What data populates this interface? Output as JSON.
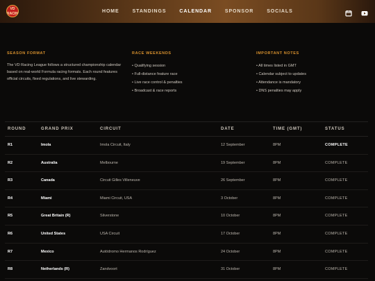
{
  "header": {
    "logo_text": "VD RACING",
    "nav": [
      "HOME",
      "STANDINGS",
      "CALENDAR",
      "SPONSOR",
      "SOCIALS"
    ],
    "active": "CALENDAR",
    "icons": [
      "calendar-icon",
      "youtube-icon"
    ],
    "accent": "#d9922e"
  },
  "info": {
    "season_format": {
      "title": "SEASON FORMAT",
      "text": "The VD Racing League follows a structured championship calendar based on real-world Formula racing formats. Each round features official circuits, fixed regulations, and live stewarding."
    },
    "race_weekends": {
      "title": "RACE WEEKENDS",
      "items": [
        "• Qualifying session",
        "• Full-distance feature race",
        "• Live race control & penalties",
        "• Broadcast & race reports"
      ]
    },
    "important_notes": {
      "title": "IMPORTANT NOTES",
      "items": [
        "• All times listed in GMT",
        "• Calendar subject to updates",
        "• Attendance is mandatory",
        "• DNS penalties may apply"
      ]
    }
  },
  "table": {
    "headers": [
      "ROUND",
      "GRAND PRIX",
      "CIRCUIT",
      "DATE",
      "TIME (GMT)",
      "STATUS"
    ],
    "rows": [
      {
        "round": "R1",
        "gp": "Imola",
        "circuit": "Imola Circuit, Italy",
        "date": "12 September",
        "time": "8PM",
        "status": "COMPLETE"
      },
      {
        "round": "R2",
        "gp": "Australia",
        "circuit": "Melbourne",
        "date": "19 September",
        "time": "8PM",
        "status": "COMPLETE"
      },
      {
        "round": "R3",
        "gp": "Canada",
        "circuit": "Circuit Gilles Villeneuve",
        "date": "26 September",
        "time": "8PM",
        "status": "COMPLETE"
      },
      {
        "round": "R4",
        "gp": "Miami",
        "circuit": "Miami Circuit, USA",
        "date": "3 October",
        "time": "8PM",
        "status": "COMPLETE"
      },
      {
        "round": "R5",
        "gp": "Great Britain (R)",
        "circuit": "Silverstone",
        "date": "10 October",
        "time": "8PM",
        "status": "COMPLETE"
      },
      {
        "round": "R6",
        "gp": "United States",
        "circuit": "USA Circuit",
        "date": "17 October",
        "time": "8PM",
        "status": "COMPLETE"
      },
      {
        "round": "R7",
        "gp": "Mexico",
        "circuit": "Autódromo Hermanos Rodríguez",
        "date": "24 October",
        "time": "8PM",
        "status": "COMPLETE"
      },
      {
        "round": "R8",
        "gp": "Netherlands (R)",
        "circuit": "Zandvoort",
        "date": "31 October",
        "time": "8PM",
        "status": "COMPLETE"
      }
    ]
  }
}
